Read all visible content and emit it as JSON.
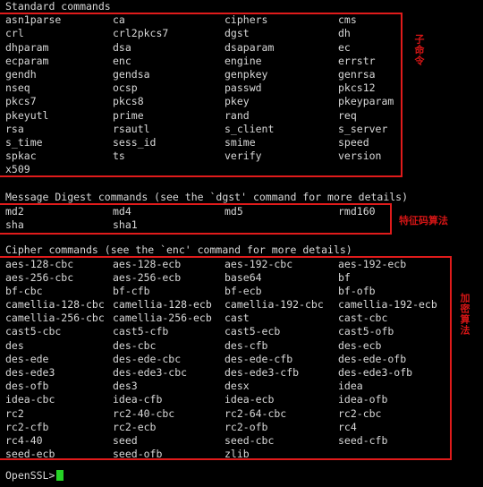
{
  "terminal": {
    "prompt": "OpenSSL>",
    "cursor": "block-cursor",
    "colors": {
      "background": "#000000",
      "foreground": "#d8d8d8",
      "annotation_red": "#d41515",
      "box_red": "#e01b1b",
      "cursor_green": "#25d425"
    }
  },
  "sections": [
    {
      "id": "standard",
      "header": "Standard commands",
      "annotation": "子命令",
      "annotation_orientation": "vertical",
      "rows": [
        [
          "asn1parse",
          "ca",
          "ciphers",
          "cms"
        ],
        [
          "crl",
          "crl2pkcs7",
          "dgst",
          "dh"
        ],
        [
          "dhparam",
          "dsa",
          "dsaparam",
          "ec"
        ],
        [
          "ecparam",
          "enc",
          "engine",
          "errstr"
        ],
        [
          "gendh",
          "gendsa",
          "genpkey",
          "genrsa"
        ],
        [
          "nseq",
          "ocsp",
          "passwd",
          "pkcs12"
        ],
        [
          "pkcs7",
          "pkcs8",
          "pkey",
          "pkeyparam"
        ],
        [
          "pkeyutl",
          "prime",
          "rand",
          "req"
        ],
        [
          "rsa",
          "rsautl",
          "s_client",
          "s_server"
        ],
        [
          "s_time",
          "sess_id",
          "smime",
          "speed"
        ],
        [
          "spkac",
          "ts",
          "verify",
          "version"
        ],
        [
          "x509",
          "",
          "",
          ""
        ]
      ]
    },
    {
      "id": "digest",
      "header": "Message Digest commands (see the `dgst' command for more details)",
      "annotation": "特征码算法",
      "annotation_orientation": "horizontal",
      "rows": [
        [
          "md2",
          "md4",
          "md5",
          "rmd160"
        ],
        [
          "sha",
          "sha1",
          "",
          ""
        ]
      ]
    },
    {
      "id": "cipher",
      "header": "Cipher commands (see the `enc' command for more details)",
      "annotation": "加密算法",
      "annotation_orientation": "vertical",
      "rows": [
        [
          "aes-128-cbc",
          "aes-128-ecb",
          "aes-192-cbc",
          "aes-192-ecb"
        ],
        [
          "aes-256-cbc",
          "aes-256-ecb",
          "base64",
          "bf"
        ],
        [
          "bf-cbc",
          "bf-cfb",
          "bf-ecb",
          "bf-ofb"
        ],
        [
          "camellia-128-cbc",
          "camellia-128-ecb",
          "camellia-192-cbc",
          "camellia-192-ecb"
        ],
        [
          "camellia-256-cbc",
          "camellia-256-ecb",
          "cast",
          "cast-cbc"
        ],
        [
          "cast5-cbc",
          "cast5-cfb",
          "cast5-ecb",
          "cast5-ofb"
        ],
        [
          "des",
          "des-cbc",
          "des-cfb",
          "des-ecb"
        ],
        [
          "des-ede",
          "des-ede-cbc",
          "des-ede-cfb",
          "des-ede-ofb"
        ],
        [
          "des-ede3",
          "des-ede3-cbc",
          "des-ede3-cfb",
          "des-ede3-ofb"
        ],
        [
          "des-ofb",
          "des3",
          "desx",
          "idea"
        ],
        [
          "idea-cbc",
          "idea-cfb",
          "idea-ecb",
          "idea-ofb"
        ],
        [
          "rc2",
          "rc2-40-cbc",
          "rc2-64-cbc",
          "rc2-cbc"
        ],
        [
          "rc2-cfb",
          "rc2-ecb",
          "rc2-ofb",
          "rc4"
        ],
        [
          "rc4-40",
          "seed",
          "seed-cbc",
          "seed-cfb"
        ],
        [
          "seed-ecb",
          "seed-ofb",
          "zlib",
          ""
        ]
      ]
    }
  ]
}
